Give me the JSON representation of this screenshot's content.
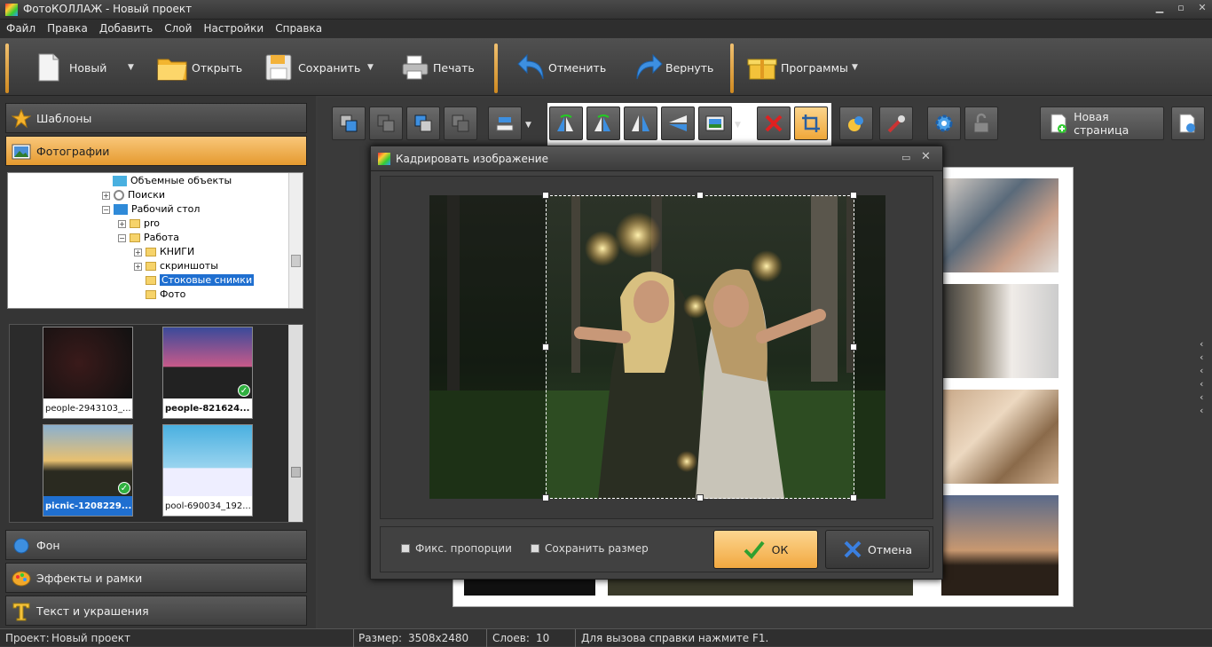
{
  "window": {
    "title": "ФотоКОЛЛАЖ - Новый проект"
  },
  "menu": [
    "Файл",
    "Правка",
    "Добавить",
    "Слой",
    "Настройки",
    "Справка"
  ],
  "toolbar": {
    "new_label": "Новый",
    "open_label": "Открыть",
    "save_label": "Сохранить",
    "print_label": "Печать",
    "undo_label": "Отменить",
    "redo_label": "Вернуть",
    "programs_label": "Программы"
  },
  "sidebar": {
    "templates": "Шаблоны",
    "photos": "Фотографии",
    "background": "Фон",
    "effects": "Эффекты и рамки",
    "text": "Текст и украшения"
  },
  "tree": {
    "items": [
      "Объемные объекты",
      "Поиски",
      "Рабочий стол",
      "pro",
      "Работа",
      "КНИГИ",
      "скриншоты",
      "Стоковые снимки",
      "Фото"
    ],
    "selected": "Стоковые снимки"
  },
  "thumbnails": [
    {
      "label": "people-2943103_...",
      "checked": false,
      "selected": false
    },
    {
      "label": "people-821624...",
      "checked": true,
      "selected": false
    },
    {
      "label": "picnic-1208229...",
      "checked": true,
      "selected": true
    },
    {
      "label": "pool-690034_192...",
      "checked": false,
      "selected": false
    }
  ],
  "new_page_label": "Новая страница",
  "dialog": {
    "title": "Кадрировать изображение",
    "fix_proportions": "Фикс. пропорции",
    "keep_size": "Сохранить размер",
    "ok": "ОК",
    "cancel": "Отмена"
  },
  "statusbar": {
    "project_label": "Проект:",
    "project_value": "Новый проект",
    "size_label": "Размер:",
    "size_value": "3508x2480",
    "layers_label": "Слоев:",
    "layers_value": "10",
    "help": "Для вызова справки нажмите F1."
  },
  "colors": {
    "accent": "#f0a83a",
    "selection": "#1f6fd0",
    "ok": "#30b040",
    "cancel_x": "#3a7fe0",
    "delete_x": "#e02020"
  }
}
